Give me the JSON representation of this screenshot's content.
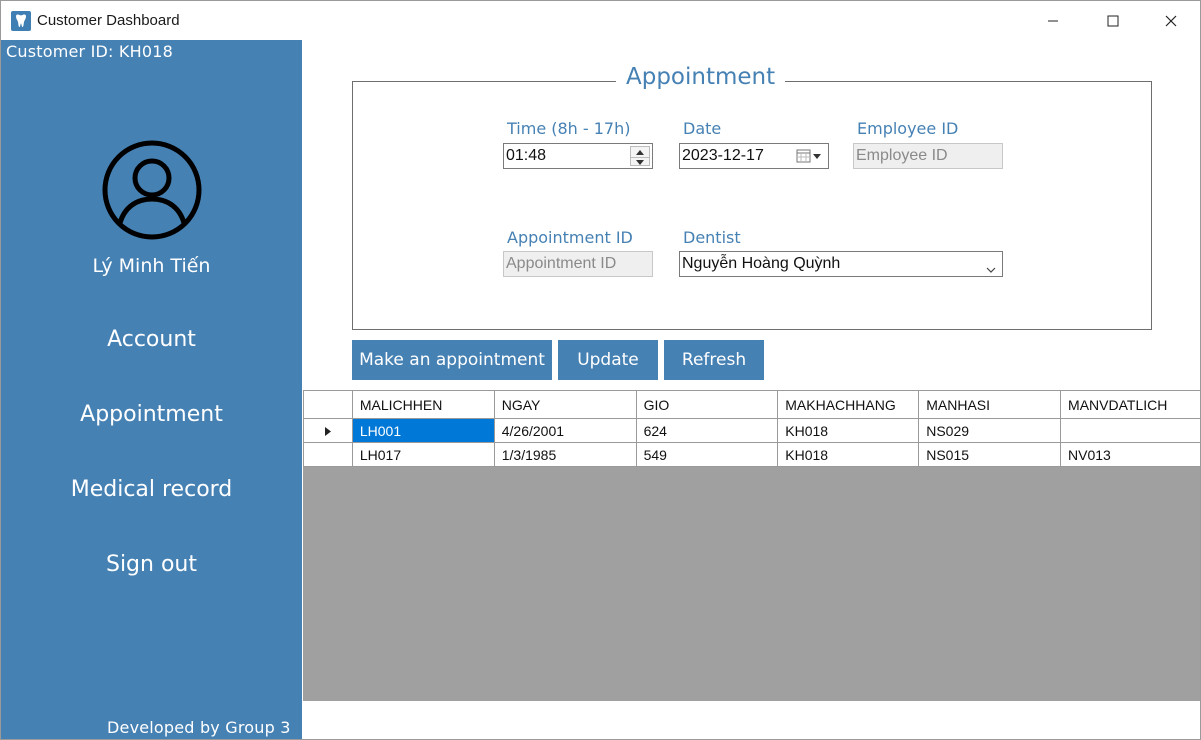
{
  "window": {
    "title": "Customer Dashboard"
  },
  "sidebar": {
    "customer_id": "Customer ID: KH018",
    "user_name": "Lý Minh Tiến",
    "nav": [
      "Account",
      "Appointment",
      "Medical record",
      "Sign out"
    ],
    "footer": "Developed by Group 3"
  },
  "form": {
    "legend": "Appointment",
    "time": {
      "label": "Time (8h - 17h)",
      "value": "01:48"
    },
    "date": {
      "label": "Date",
      "value": "2023-12-17"
    },
    "employee_id": {
      "label": "Employee ID",
      "placeholder": "Employee ID"
    },
    "appointment_id": {
      "label": "Appointment ID",
      "placeholder": "Appointment ID"
    },
    "dentist": {
      "label": "Dentist",
      "value": "Nguyễn Hoàng Quỳnh"
    }
  },
  "buttons": {
    "make": "Make an appointment",
    "update": "Update",
    "refresh": "Refresh"
  },
  "grid": {
    "columns": [
      "MALICHHEN",
      "NGAY",
      "GIO",
      "MAKHACHHANG",
      "MANHASI",
      "MANVDATLICH"
    ],
    "rows": [
      [
        "LH001",
        "4/26/2001",
        "624",
        "KH018",
        "NS029",
        ""
      ],
      [
        "LH017",
        "1/3/1985",
        "549",
        "KH018",
        "NS015",
        "NV013"
      ]
    ],
    "selected_row": 0
  },
  "colors": {
    "accent": "#4681b4",
    "selection": "#0078d7",
    "grid_empty": "#a0a0a0"
  }
}
